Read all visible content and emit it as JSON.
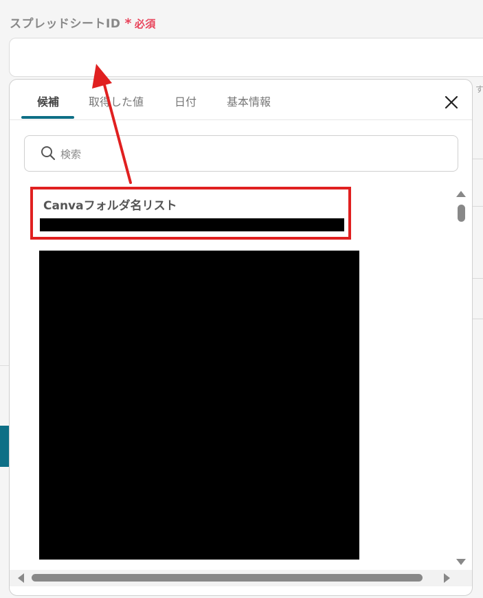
{
  "field": {
    "label": "スプレッドシートID",
    "required_star": "*",
    "required_text": "必須"
  },
  "background": {
    "hint_fragment": "す"
  },
  "popup": {
    "tabs": [
      {
        "label": "候補",
        "active": true
      },
      {
        "label": "取得した値",
        "active": false
      },
      {
        "label": "日付",
        "active": false
      },
      {
        "label": "基本情報",
        "active": false
      }
    ],
    "close_icon": "close-icon",
    "search": {
      "placeholder": "検索",
      "icon": "search-icon"
    },
    "candidates": [
      {
        "title": "Canvaフォルダ名リスト"
      }
    ]
  },
  "colors": {
    "accent": "#0e6f86",
    "required": "#e8435a",
    "annotation": "#e02020"
  }
}
